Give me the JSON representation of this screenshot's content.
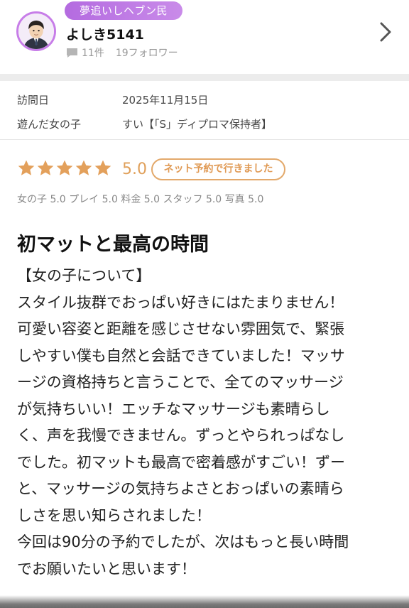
{
  "user": {
    "rank_badge": "夢追いしヘブン民",
    "name": "よしき5141",
    "review_count": "11件",
    "follower_count": "19フォロワー",
    "avatar_icon": "user-avatar-icon",
    "comment_icon": "comment-icon",
    "nav_icon": "chevron-right-icon",
    "accent_color": "#b46be0"
  },
  "visit": {
    "date_label": "訪問日",
    "date_value": "2025年11月15日",
    "girl_label": "遊んだ女の子",
    "girl_value": "すい【「S」ディプロマ保持者】"
  },
  "rating": {
    "stars": 5,
    "max_stars": 5,
    "score": "5.0",
    "badge": "ネット予約で行きました",
    "star_color": "#e3a05b",
    "sub_scores": "女の子 5.0 プレイ 5.0 料金 5.0 スタッフ 5.0 写真 5.0"
  },
  "review": {
    "title": "初マットと最高の時間",
    "body": "【女の子について】\nスタイル抜群でおっぱい好きにはたまりません！\n可愛い容姿と距離を感じさせない雰囲気で、緊張\nしやすい僕も自然と会話できていました！マッサ\nージの資格持ちと言うことで、全てのマッサージ\nが気持ちいい！エッチなマッサージも素晴らし\nく、声を我慢できません。ずっとやられっぱなし\nでした。初マットも最高で密着感がすごい！ずー\nと、マッサージの気持ちよさとおっぱいの素晴ら\nしさを思い知らされました！\n今回は90分の予約でしたが、次はもっと長い時間\nでお願いたいと思います！"
  }
}
